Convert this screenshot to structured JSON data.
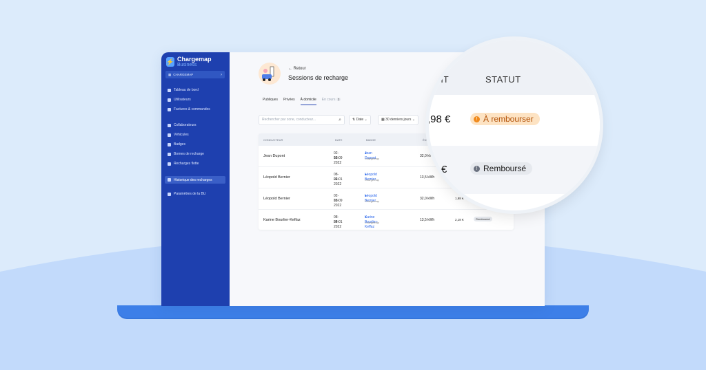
{
  "sidebar": {
    "brand_name": "Chargemap",
    "brand_sub": "Business",
    "bu_select": "CHARGEMAP",
    "items": [
      {
        "label": "Tableau de bord"
      },
      {
        "label": "Utilisateurs"
      },
      {
        "label": "Factures & commandes"
      },
      {
        "label": "Collaborateurs"
      },
      {
        "label": "Véhicules"
      },
      {
        "label": "Badges"
      },
      {
        "label": "Bornes de recharge"
      },
      {
        "label": "Recharges flotte"
      },
      {
        "label": "Historique des recharges"
      },
      {
        "label": "Paramètres de la BU"
      }
    ]
  },
  "header": {
    "back": "Retour",
    "title": "Sessions de recharge"
  },
  "tabs": [
    {
      "label": "Publiques"
    },
    {
      "label": "Privées"
    },
    {
      "label": "À domicile"
    },
    {
      "label": "En cours",
      "count": "3"
    }
  ],
  "filters": {
    "search_placeholder": "Rechercher par zone, conducteur...",
    "date": "Date",
    "period": "30 derniers jours"
  },
  "table": {
    "headers": [
      "CONDUCTEUR",
      "DATE",
      "BADGE",
      "ÉN"
    ],
    "rows": [
      {
        "conducteur": "Jean Dupont",
        "date": "02-05-2022",
        "time": "12:09",
        "badge": "Jean Dupont",
        "badge_sub": "Chargemap",
        "energy": "32,0 kWh",
        "amount": "",
        "status": ""
      },
      {
        "conducteur": "Léopold Bernier",
        "date": "08-04-2022",
        "time": "22:01",
        "badge": "Léopold Bernier",
        "badge_sub": "Chargemap",
        "energy": "13,5 kWh",
        "amount": "",
        "status": ""
      },
      {
        "conducteur": "Léopold Bernier",
        "date": "02-05-2022",
        "time": "12:09",
        "badge": "Léopold Bernier",
        "badge_sub": "Chargemap",
        "energy": "32,0 kWh",
        "amount": "1,98 €",
        "status": ""
      },
      {
        "conducteur": "Karine Bourlier-Keffaz",
        "date": "08-04-2022",
        "time": "22:01",
        "badge": "Karine Bourlier-Keffaz",
        "badge_sub": "Chargemap",
        "energy": "13,5 kWh",
        "amount": "2,18 €",
        "status": "Remboursé"
      }
    ]
  },
  "zoom": {
    "col_amount": "T HT",
    "col_status": "STATUT",
    "amount1": ",98 €",
    "amount2": "€",
    "status1": "À rembourser",
    "status2": "Remboursé"
  },
  "colors": {
    "sidebar": "#1e40af",
    "accent": "#2563eb",
    "pending": "#f08a1c"
  }
}
